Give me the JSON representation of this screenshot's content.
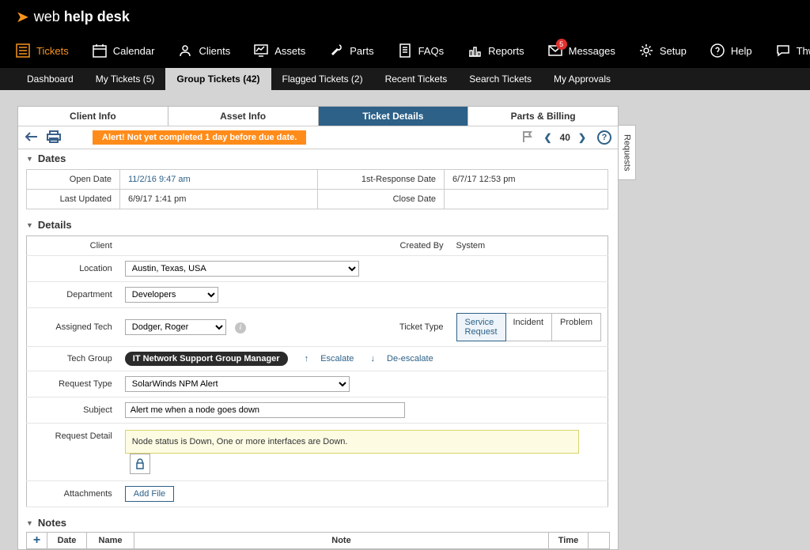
{
  "brand": {
    "name_prefix": "web ",
    "name_bold": "help desk"
  },
  "primary_nav": [
    {
      "id": "tickets",
      "label": "Tickets",
      "active": true
    },
    {
      "id": "calendar",
      "label": "Calendar",
      "active": false
    },
    {
      "id": "clients",
      "label": "Clients",
      "active": false
    },
    {
      "id": "assets",
      "label": "Assets",
      "active": false
    },
    {
      "id": "parts",
      "label": "Parts",
      "active": false
    },
    {
      "id": "faqs",
      "label": "FAQs",
      "active": false
    },
    {
      "id": "reports",
      "label": "Reports",
      "active": false
    },
    {
      "id": "messages",
      "label": "Messages",
      "active": false,
      "badge": "5"
    },
    {
      "id": "setup",
      "label": "Setup",
      "active": false
    },
    {
      "id": "help",
      "label": "Help",
      "active": false
    },
    {
      "id": "thwack",
      "label": "Thwack",
      "active": false
    }
  ],
  "sub_nav": [
    {
      "label": "Dashboard",
      "active": false
    },
    {
      "label": "My Tickets (5)",
      "active": false
    },
    {
      "label": "Group Tickets (42)",
      "active": true
    },
    {
      "label": "Flagged Tickets (2)",
      "active": false
    },
    {
      "label": "Recent Tickets",
      "active": false
    },
    {
      "label": "Search Tickets",
      "active": false
    },
    {
      "label": "My Approvals",
      "active": false
    }
  ],
  "tabs": {
    "client_info": "Client Info",
    "asset_info": "Asset Info",
    "ticket_details": "Ticket Details",
    "parts_billing": "Parts & Billing"
  },
  "toolbar": {
    "alert": "Alert! Not yet completed 1 day before due date.",
    "record_number": "40"
  },
  "sections": {
    "dates": "Dates",
    "details": "Details",
    "notes": "Notes"
  },
  "dates": {
    "open_label": "Open Date",
    "open_value": "11/2/16 9:47 am",
    "first_label": "1st-Response Date",
    "first_value": "6/7/17 12:53 pm",
    "updated_label": "Last Updated",
    "updated_value": "6/9/17 1:41 pm",
    "close_label": "Close Date",
    "close_value": ""
  },
  "details": {
    "client_label": "Client",
    "client_value": "",
    "created_label": "Created By",
    "created_value": "System",
    "location_label": "Location",
    "location_value": "Austin, Texas, USA",
    "dept_label": "Department",
    "dept_value": "Developers",
    "tech_label": "Assigned Tech",
    "tech_value": "Dodger, Roger",
    "type_label": "Ticket Type",
    "type_options": {
      "a": "Service Request",
      "b": "Incident",
      "c": "Problem"
    },
    "group_label": "Tech Group",
    "group_value": "IT Network Support  Group Manager",
    "escalate": "Escalate",
    "deescalate": "De-escalate",
    "reqtype_label": "Request Type",
    "reqtype_value": "SolarWinds NPM Alert",
    "subject_label": "Subject",
    "subject_value": "Alert me when a node goes down",
    "detail_label": "Request Detail",
    "detail_value": "Node status is Down, One or more interfaces are Down.",
    "attach_label": "Attachments",
    "add_file": "Add File"
  },
  "notes": {
    "cols": {
      "date": "Date",
      "name": "Name",
      "note": "Note",
      "time": "Time"
    }
  },
  "side_tab": "Requests"
}
